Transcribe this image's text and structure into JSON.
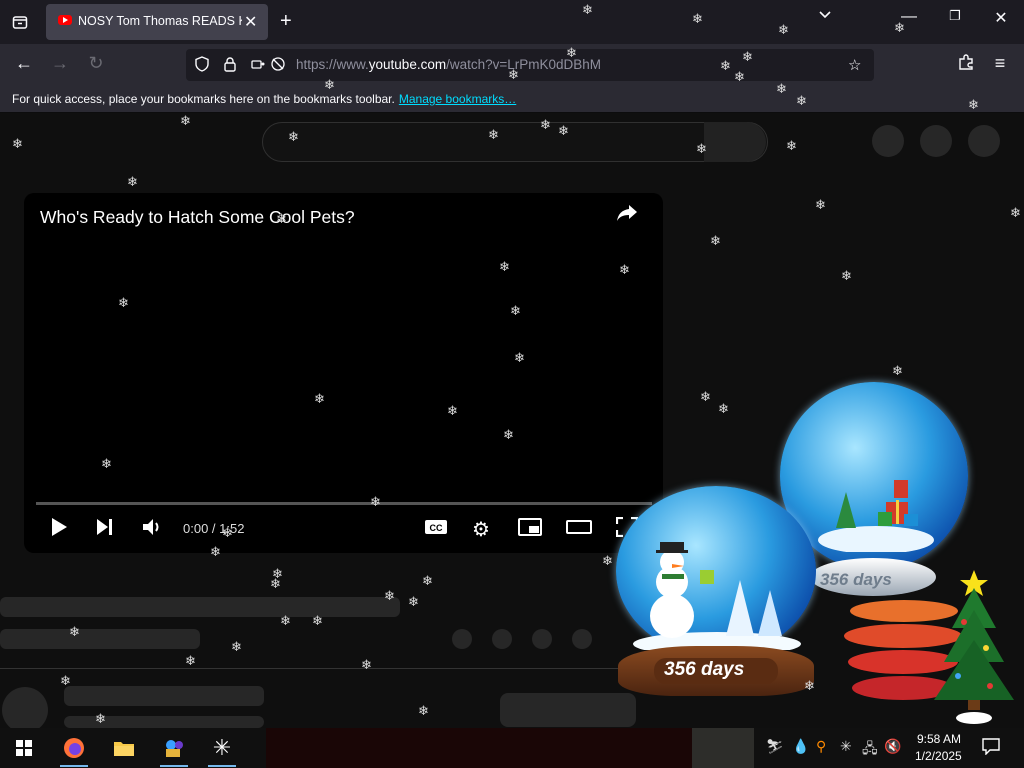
{
  "browser": {
    "tab": {
      "title": "NOSY Tom Thomas READS Kat"
    },
    "url": {
      "prefix": "https://www.",
      "domain": "youtube.com",
      "rest": "/watch?v=LrPmK0dDBhM"
    },
    "bookmarks_bar": {
      "text": "For quick access, place your bookmarks here on the bookmarks toolbar.",
      "link": "Manage bookmarks…"
    }
  },
  "player": {
    "title": "Who's Ready to Hatch Some Cool Pets?",
    "time": "0:00 / 1:52",
    "progress": 0
  },
  "desktop": {
    "globe_small_label": "356 days",
    "globe_large_label": "356 days"
  },
  "taskbar": {
    "time": "9:58 AM",
    "date": "1/2/2025"
  },
  "icons": {
    "tab_list": "tab-list-icon",
    "back": "back-arrow-icon",
    "forward": "forward-arrow-icon",
    "reload": "reload-icon",
    "shield": "shield-icon",
    "lock": "lock-icon",
    "bookmark_star": "star-icon",
    "extensions": "puzzle-icon",
    "menu": "hamburger-icon"
  }
}
